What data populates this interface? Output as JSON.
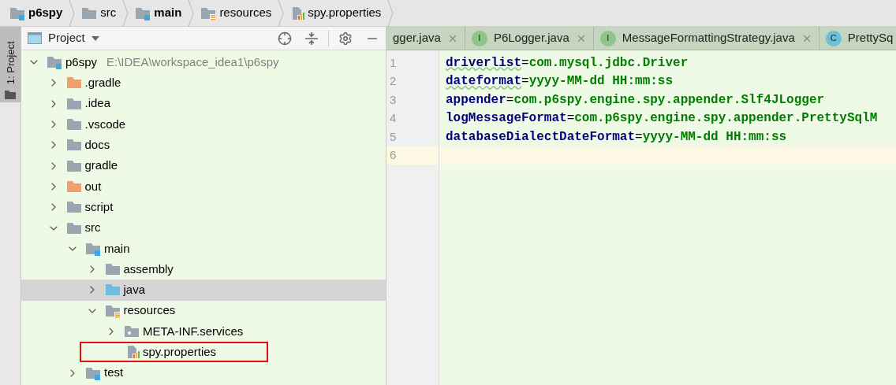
{
  "breadcrumbs": [
    {
      "label": "p6spy",
      "kind": "module"
    },
    {
      "label": "src",
      "kind": "folder"
    },
    {
      "label": "main",
      "kind": "module"
    },
    {
      "label": "resources",
      "kind": "resources"
    },
    {
      "label": "spy.properties",
      "kind": "properties"
    }
  ],
  "tool_strip": {
    "label": "1: Project"
  },
  "project_panel": {
    "title": "Project",
    "tree": [
      {
        "label": "p6spy",
        "path": "E:\\IDEA\\workspace_idea1\\p6spy",
        "kind": "module",
        "expanded": true,
        "selected": false,
        "outlined": false,
        "children": [
          {
            "label": ".gradle",
            "kind": "excluded",
            "expanded": false,
            "selected": false,
            "outlined": false
          },
          {
            "label": ".idea",
            "kind": "folder",
            "expanded": false,
            "selected": false,
            "outlined": false
          },
          {
            "label": ".vscode",
            "kind": "folder",
            "expanded": false,
            "selected": false,
            "outlined": false
          },
          {
            "label": "docs",
            "kind": "folder",
            "expanded": false,
            "selected": false,
            "outlined": false
          },
          {
            "label": "gradle",
            "kind": "folder",
            "expanded": false,
            "selected": false,
            "outlined": false
          },
          {
            "label": "out",
            "kind": "excluded",
            "expanded": false,
            "selected": false,
            "outlined": false
          },
          {
            "label": "script",
            "kind": "folder",
            "expanded": false,
            "selected": false,
            "outlined": false
          },
          {
            "label": "src",
            "kind": "folder",
            "expanded": true,
            "selected": false,
            "outlined": false,
            "children": [
              {
                "label": "main",
                "kind": "module",
                "expanded": true,
                "selected": false,
                "outlined": false,
                "children": [
                  {
                    "label": "assembly",
                    "kind": "folder",
                    "expanded": false,
                    "selected": false,
                    "outlined": false
                  },
                  {
                    "label": "java",
                    "kind": "source",
                    "expanded": false,
                    "selected": true,
                    "outlined": false
                  },
                  {
                    "label": "resources",
                    "kind": "resources",
                    "expanded": true,
                    "selected": false,
                    "outlined": false,
                    "children": [
                      {
                        "label": "META-INF.services",
                        "kind": "package",
                        "expanded": false,
                        "selected": false,
                        "outlined": false
                      },
                      {
                        "label": "spy.properties",
                        "kind": "properties",
                        "selected": false,
                        "outlined": true
                      }
                    ]
                  }
                ]
              },
              {
                "label": "test",
                "kind": "module",
                "expanded": false,
                "selected": false,
                "outlined": false
              }
            ]
          }
        ]
      }
    ]
  },
  "editor_tabs": [
    {
      "label": "gger.java",
      "kind": "cut"
    },
    {
      "label": "P6Logger.java",
      "kind": "interface",
      "badge": "I"
    },
    {
      "label": "MessageFormattingStrategy.java",
      "kind": "interface",
      "badge": "I"
    },
    {
      "label": "PrettySq",
      "kind": "class",
      "badge": "C"
    }
  ],
  "code_lines": [
    {
      "number": "1",
      "key": "driverlist",
      "sep": "=",
      "value": "com.mysql.jdbc.Driver",
      "typo": true,
      "current": false
    },
    {
      "number": "2",
      "key": "dateformat",
      "sep": "=",
      "value": "yyyy-MM-dd HH:mm:ss",
      "typo": true,
      "current": false
    },
    {
      "number": "3",
      "key": "appender",
      "sep": "=",
      "value": "com.p6spy.engine.spy.appender.Slf4JLogger",
      "typo": false,
      "current": false
    },
    {
      "number": "4",
      "key": "logMessageFormat",
      "sep": "=",
      "value": "com.p6spy.engine.spy.appender.PrettySqlM",
      "typo": false,
      "current": false
    },
    {
      "number": "5",
      "key": "databaseDialectDateFormat",
      "sep": "=",
      "value": "yyyy-MM-dd HH:mm:ss",
      "typo": false,
      "current": false
    },
    {
      "number": "6",
      "current": true
    }
  ]
}
